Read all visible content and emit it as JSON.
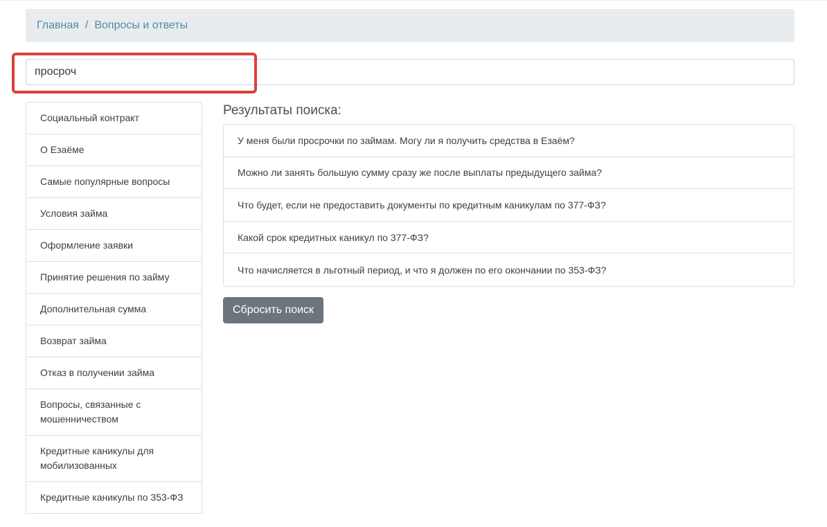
{
  "breadcrumb": {
    "items": [
      "Главная",
      "Вопросы и ответы"
    ],
    "separator": "/"
  },
  "search": {
    "value": "просроч"
  },
  "sidebar": {
    "items": [
      {
        "label": "Социальный контракт"
      },
      {
        "label": "О Езаёме"
      },
      {
        "label": "Самые популярные вопросы"
      },
      {
        "label": "Условия займа"
      },
      {
        "label": "Оформление заявки"
      },
      {
        "label": "Принятие решения по займу"
      },
      {
        "label": "Дополнительная сумма"
      },
      {
        "label": "Возврат займа"
      },
      {
        "label": "Отказ в получении займа"
      },
      {
        "label": "Вопросы, связанные с мошенничеством"
      },
      {
        "label": "Кредитные каникулы для мобилизованных"
      },
      {
        "label": "Кредитные каникулы по 353-ФЗ"
      }
    ]
  },
  "results": {
    "title": "Результаты поиска:",
    "items": [
      {
        "label": "У меня были просрочки по займам. Могу ли я получить средства в Езаём?"
      },
      {
        "label": "Можно ли занять большую сумму сразу же после выплаты предыдущего займа?"
      },
      {
        "label": "Что будет, если не предоставить документы по кредитным каникулам по 377-ФЗ?"
      },
      {
        "label": "Какой срок кредитных каникул по 377-ФЗ?"
      },
      {
        "label": "Что начисляется в льготный период, и что я должен по его окончании по 353-ФЗ?"
      }
    ],
    "reset_label": "Сбросить поиск"
  },
  "colors": {
    "link": "#4a8fa3",
    "highlight": "#d9413a",
    "button": "#6c757d",
    "breadcrumb_bg": "#e9ecef"
  }
}
